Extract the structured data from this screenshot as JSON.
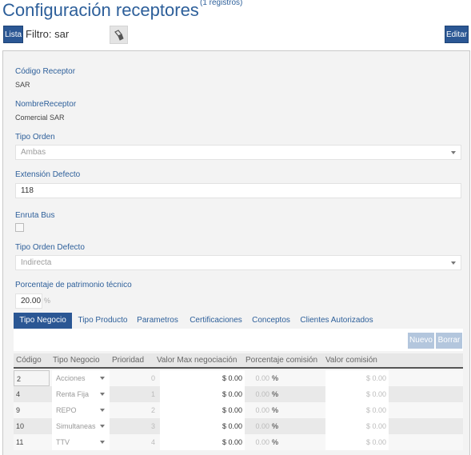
{
  "header": {
    "title": "Configuración receptores",
    "count": "(1 registros)"
  },
  "toolbar": {
    "list_label": "Lista",
    "filter_label": "Filtro: sar",
    "clear_filter_icon": "eraser-icon",
    "edit_label": "Editar"
  },
  "form": {
    "codigo_label": "Código Receptor",
    "codigo_value": "SAR",
    "nombre_label": "NombreReceptor",
    "nombre_value": "Comercial SAR",
    "tipo_orden_label": "Tipo Orden",
    "tipo_orden_value": "Ambas",
    "extension_label": "Extensión Defecto",
    "extension_value": "118",
    "enruta_label": "Enruta Bus",
    "enruta_checked": false,
    "tipo_orden_defecto_label": "Tipo Orden Defecto",
    "tipo_orden_defecto_value": "Indirecta",
    "porcentaje_label": "Porcentaje de patrimonio técnico",
    "porcentaje_value": "20.00",
    "porcentaje_suffix": "%"
  },
  "tabs": [
    {
      "label": "Tipo Negocio",
      "active": true
    },
    {
      "label": "Tipo Producto",
      "active": false
    },
    {
      "label": "Parametros",
      "active": false
    },
    {
      "label": "Certificaciones",
      "active": false
    },
    {
      "label": "Conceptos",
      "active": false
    },
    {
      "label": "Clientes Autorizados",
      "active": false
    }
  ],
  "grid_toolbar": {
    "new_label": "Nuevo",
    "delete_label": "Borrar"
  },
  "grid": {
    "columns": [
      "Código",
      "Tipo Negocio",
      "Prioridad",
      "Valor Max negociación",
      "Porcentaje comisión",
      "Valor comisión"
    ],
    "rows": [
      {
        "codigo": "2",
        "tipo": "Acciones",
        "prioridad": "0",
        "valor_max": "$ 0.00",
        "porcentaje": "0.00",
        "pct_symbol": "%",
        "valor_comision": "$ 0.00"
      },
      {
        "codigo": "4",
        "tipo": "Renta Fija",
        "prioridad": "1",
        "valor_max": "$ 0.00",
        "porcentaje": "0.00",
        "pct_symbol": "%",
        "valor_comision": "$ 0.00"
      },
      {
        "codigo": "9",
        "tipo": "REPO",
        "prioridad": "2",
        "valor_max": "$ 0.00",
        "porcentaje": "0.00",
        "pct_symbol": "%",
        "valor_comision": "$ 0.00"
      },
      {
        "codigo": "10",
        "tipo": "Simultaneas",
        "prioridad": "3",
        "valor_max": "$ 0.00",
        "porcentaje": "0.00",
        "pct_symbol": "%",
        "valor_comision": "$ 0.00"
      },
      {
        "codigo": "11",
        "tipo": "TTV",
        "prioridad": "4",
        "valor_max": "$ 0.00",
        "porcentaje": "0.00",
        "pct_symbol": "%",
        "valor_comision": "$ 0.00"
      }
    ]
  },
  "colors": {
    "accent": "#2b5794",
    "title": "#2d5f9a",
    "disabled_button": "#b3c6dd"
  }
}
